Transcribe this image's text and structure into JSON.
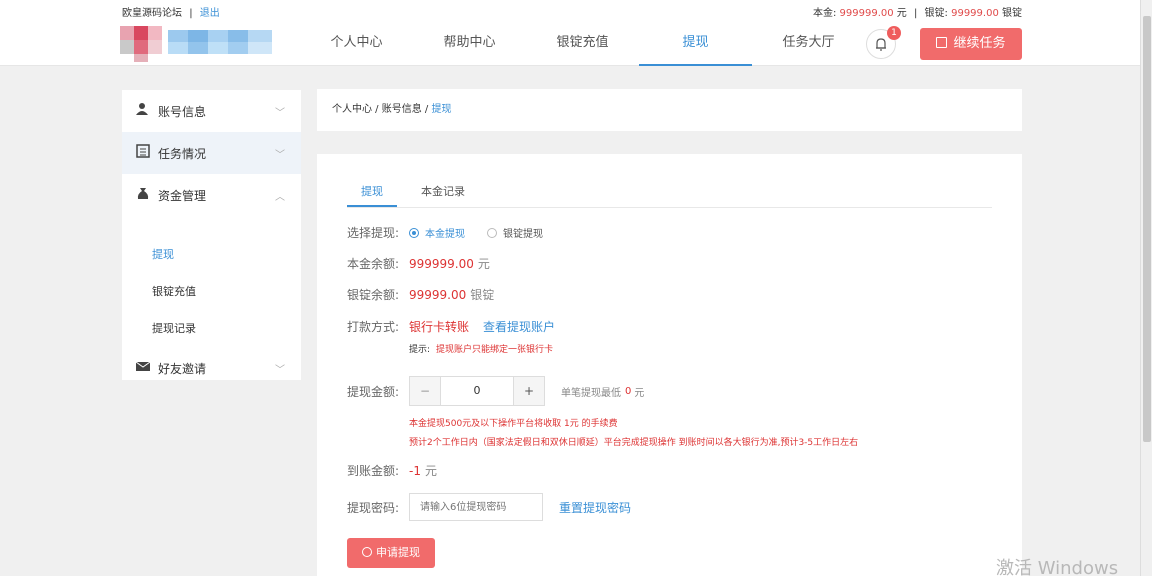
{
  "topbar": {
    "site_name": "欧皇源码论坛",
    "logout": "退出",
    "principal_label": "本金:",
    "principal_value": "999999.00",
    "principal_unit": "元",
    "sep": "|",
    "ingot_label": "银锭:",
    "ingot_value": "99999.00",
    "ingot_unit": "银锭"
  },
  "nav": {
    "items": [
      "个人中心",
      "帮助中心",
      "银锭充值",
      "提现",
      "任务大厅"
    ],
    "active_index": 3,
    "bell_badge": "1",
    "continue_button": "继续任务"
  },
  "sidebar": {
    "account": "账号信息",
    "tasks": "任务情况",
    "funds": "资金管理",
    "sub_items": [
      "提现",
      "银锭充值",
      "提现记录"
    ],
    "friends": "好友邀请"
  },
  "breadcrumb": {
    "part1": "个人中心",
    "sep": " / ",
    "part2": "账号信息",
    "current": "提现"
  },
  "form": {
    "tabs": [
      "提现",
      "本金记录"
    ],
    "select_label": "选择提现:",
    "option_principal": "本金提现",
    "option_ingot": "银锭提现",
    "principal_balance_label": "本金余额:",
    "principal_balance_value": "999999.00",
    "principal_balance_unit": "元",
    "ingot_balance_label": "银锭余额:",
    "ingot_balance_value": "99999.00",
    "ingot_balance_unit": "银锭",
    "payment_label": "打款方式:",
    "payment_value": "银行卡转账",
    "view_account_link": "查看提现账户",
    "tip_prefix": "提示:",
    "tip_text": "提现账户只能绑定一张银行卡",
    "amount_label": "提现金额:",
    "amount_minus": "−",
    "amount_value": "0",
    "amount_plus": "+",
    "min_text": "单笔提现最低",
    "min_value": "0",
    "min_unit": "元",
    "fee_note": "本金提现500元及以下操作平台将收取 1元 的手续费",
    "time_note": "预计2个工作日内（国家法定假日和双休日顺延）平台完成提现操作 到账时间以各大银行为准,预计3-5工作日左右",
    "arrival_label": "到账金额:",
    "arrival_value": "-1",
    "arrival_unit": "元",
    "password_label": "提现密码:",
    "password_placeholder": "请输入6位提现密码",
    "reset_password_link": "重置提现密码",
    "submit_button": "申请提现"
  },
  "watermark": "激活 Windows",
  "colors": {
    "accent": "#3a8fd5",
    "danger": "#f16b6b",
    "red_text": "#d33333"
  }
}
